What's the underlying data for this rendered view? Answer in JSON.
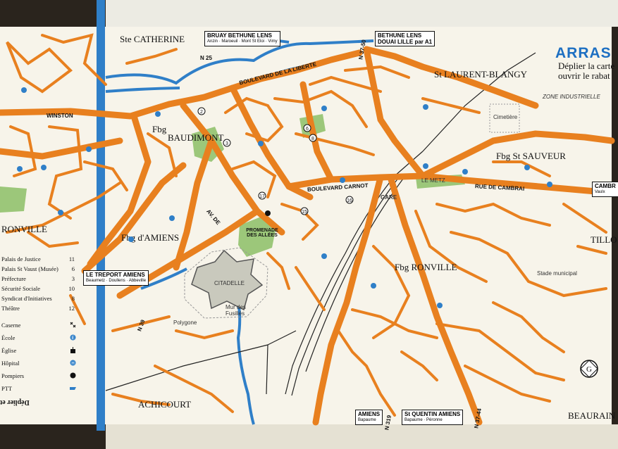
{
  "title": "ARRAS",
  "title_note": [
    "Déplier la carte",
    "ouvrir le rabat"
  ],
  "districts": [
    {
      "id": "ste-catherine",
      "text": "Ste CATHERINE"
    },
    {
      "id": "st-laurent",
      "text": "St LAURENT-BLANGY"
    },
    {
      "id": "baudimont",
      "text": "BAUDIMONT"
    },
    {
      "id": "fbg-baudimont",
      "text": "Fbg"
    },
    {
      "id": "fbg-st-sauveur",
      "text": "Fbg St SAUVEUR"
    },
    {
      "id": "fbg-amiens",
      "text": "Fbg d'AMIENS"
    },
    {
      "id": "fbg-ronville",
      "text": "Fbg RONVILLE"
    },
    {
      "id": "achicourt",
      "text": "ACHICOURT"
    },
    {
      "id": "beaurains",
      "text": "BEAURAIN"
    },
    {
      "id": "tillo",
      "text": "TILLO"
    },
    {
      "id": "ronville-left",
      "text": "RONVILLE"
    }
  ],
  "direction_boxes": [
    {
      "id": "bruay",
      "lines": [
        "BRUAY BETHUNE LENS"
      ],
      "sub": "Anzin · Maroeuil · Mont St Eloi · Vimy"
    },
    {
      "id": "bethune",
      "lines": [
        "BETHUNE LENS",
        "DOUAI LILLE par A1"
      ],
      "sub": ""
    },
    {
      "id": "treport",
      "lines": [
        "LE TREPORT AMIENS"
      ],
      "sub": "Beaumetz · Doullens · Abbeville"
    },
    {
      "id": "amiens-bottom",
      "lines": [
        "AMIENS"
      ],
      "sub": "Bapaume"
    },
    {
      "id": "stquentin",
      "lines": [
        "St QUENTIN AMIENS"
      ],
      "sub": "Bapaume · Péronne"
    },
    {
      "id": "cambrai",
      "lines": [
        "CAMBR"
      ],
      "sub": "Vaulx"
    }
  ],
  "streets": [
    {
      "id": "winston",
      "text": "WINSTON"
    },
    {
      "id": "bd-carnot",
      "text": "BOULEVARD CARNOT"
    },
    {
      "id": "rue-cambrai",
      "text": "RUE   DE   CAMBRAI"
    },
    {
      "id": "av-amiens",
      "text": "AV. DE"
    },
    {
      "id": "promenade",
      "text": "PROMENADE DES ALLÉES"
    },
    {
      "id": "liberte",
      "text": "BOULEVARD DE LA LIBERTE"
    },
    {
      "id": "zone",
      "text": "ZONE INDUSTRIELLE"
    },
    {
      "id": "gare",
      "text": "GARE"
    },
    {
      "id": "citadelle",
      "text": "CITADELLE"
    },
    {
      "id": "mur",
      "text": "Mur des Fusillés"
    },
    {
      "id": "cimetiere",
      "text": "Cimetière"
    },
    {
      "id": "polygone",
      "text": "Polygone"
    },
    {
      "id": "stade",
      "text": "Stade municipal"
    },
    {
      "id": "le-metz",
      "text": "LE METZ"
    }
  ],
  "roads": [
    "N 25",
    "N 39",
    "N 37-50",
    "N 319",
    "N 37-44"
  ],
  "legend": [
    {
      "label": "Palais de Justice",
      "num": "11"
    },
    {
      "label": "Palais St Vaust (Musée)",
      "num": "6"
    },
    {
      "label": "Préfecture",
      "num": "3"
    },
    {
      "label": "Sécurité Sociale",
      "num": "10"
    },
    {
      "label": "Syndicat d'Initiatives",
      "num": "8"
    },
    {
      "label": "Théâtre",
      "num": "12"
    }
  ],
  "legend_symbols": [
    {
      "label": "Caserne",
      "icon": "caserne-icon"
    },
    {
      "label": "École",
      "icon": "ecole-icon"
    },
    {
      "label": "Église",
      "icon": "eglise-icon"
    },
    {
      "label": "Hôpital",
      "icon": "hopital-icon"
    },
    {
      "label": "Pompiers",
      "icon": "pompiers-icon"
    },
    {
      "label": "PTT",
      "icon": "ptt-icon"
    }
  ],
  "bottom_left_note": "Déplier et",
  "colors": {
    "road": "#e8801f",
    "water": "#2f7fc8",
    "park": "#8fbf6a",
    "paper": "#f7f4ea"
  }
}
